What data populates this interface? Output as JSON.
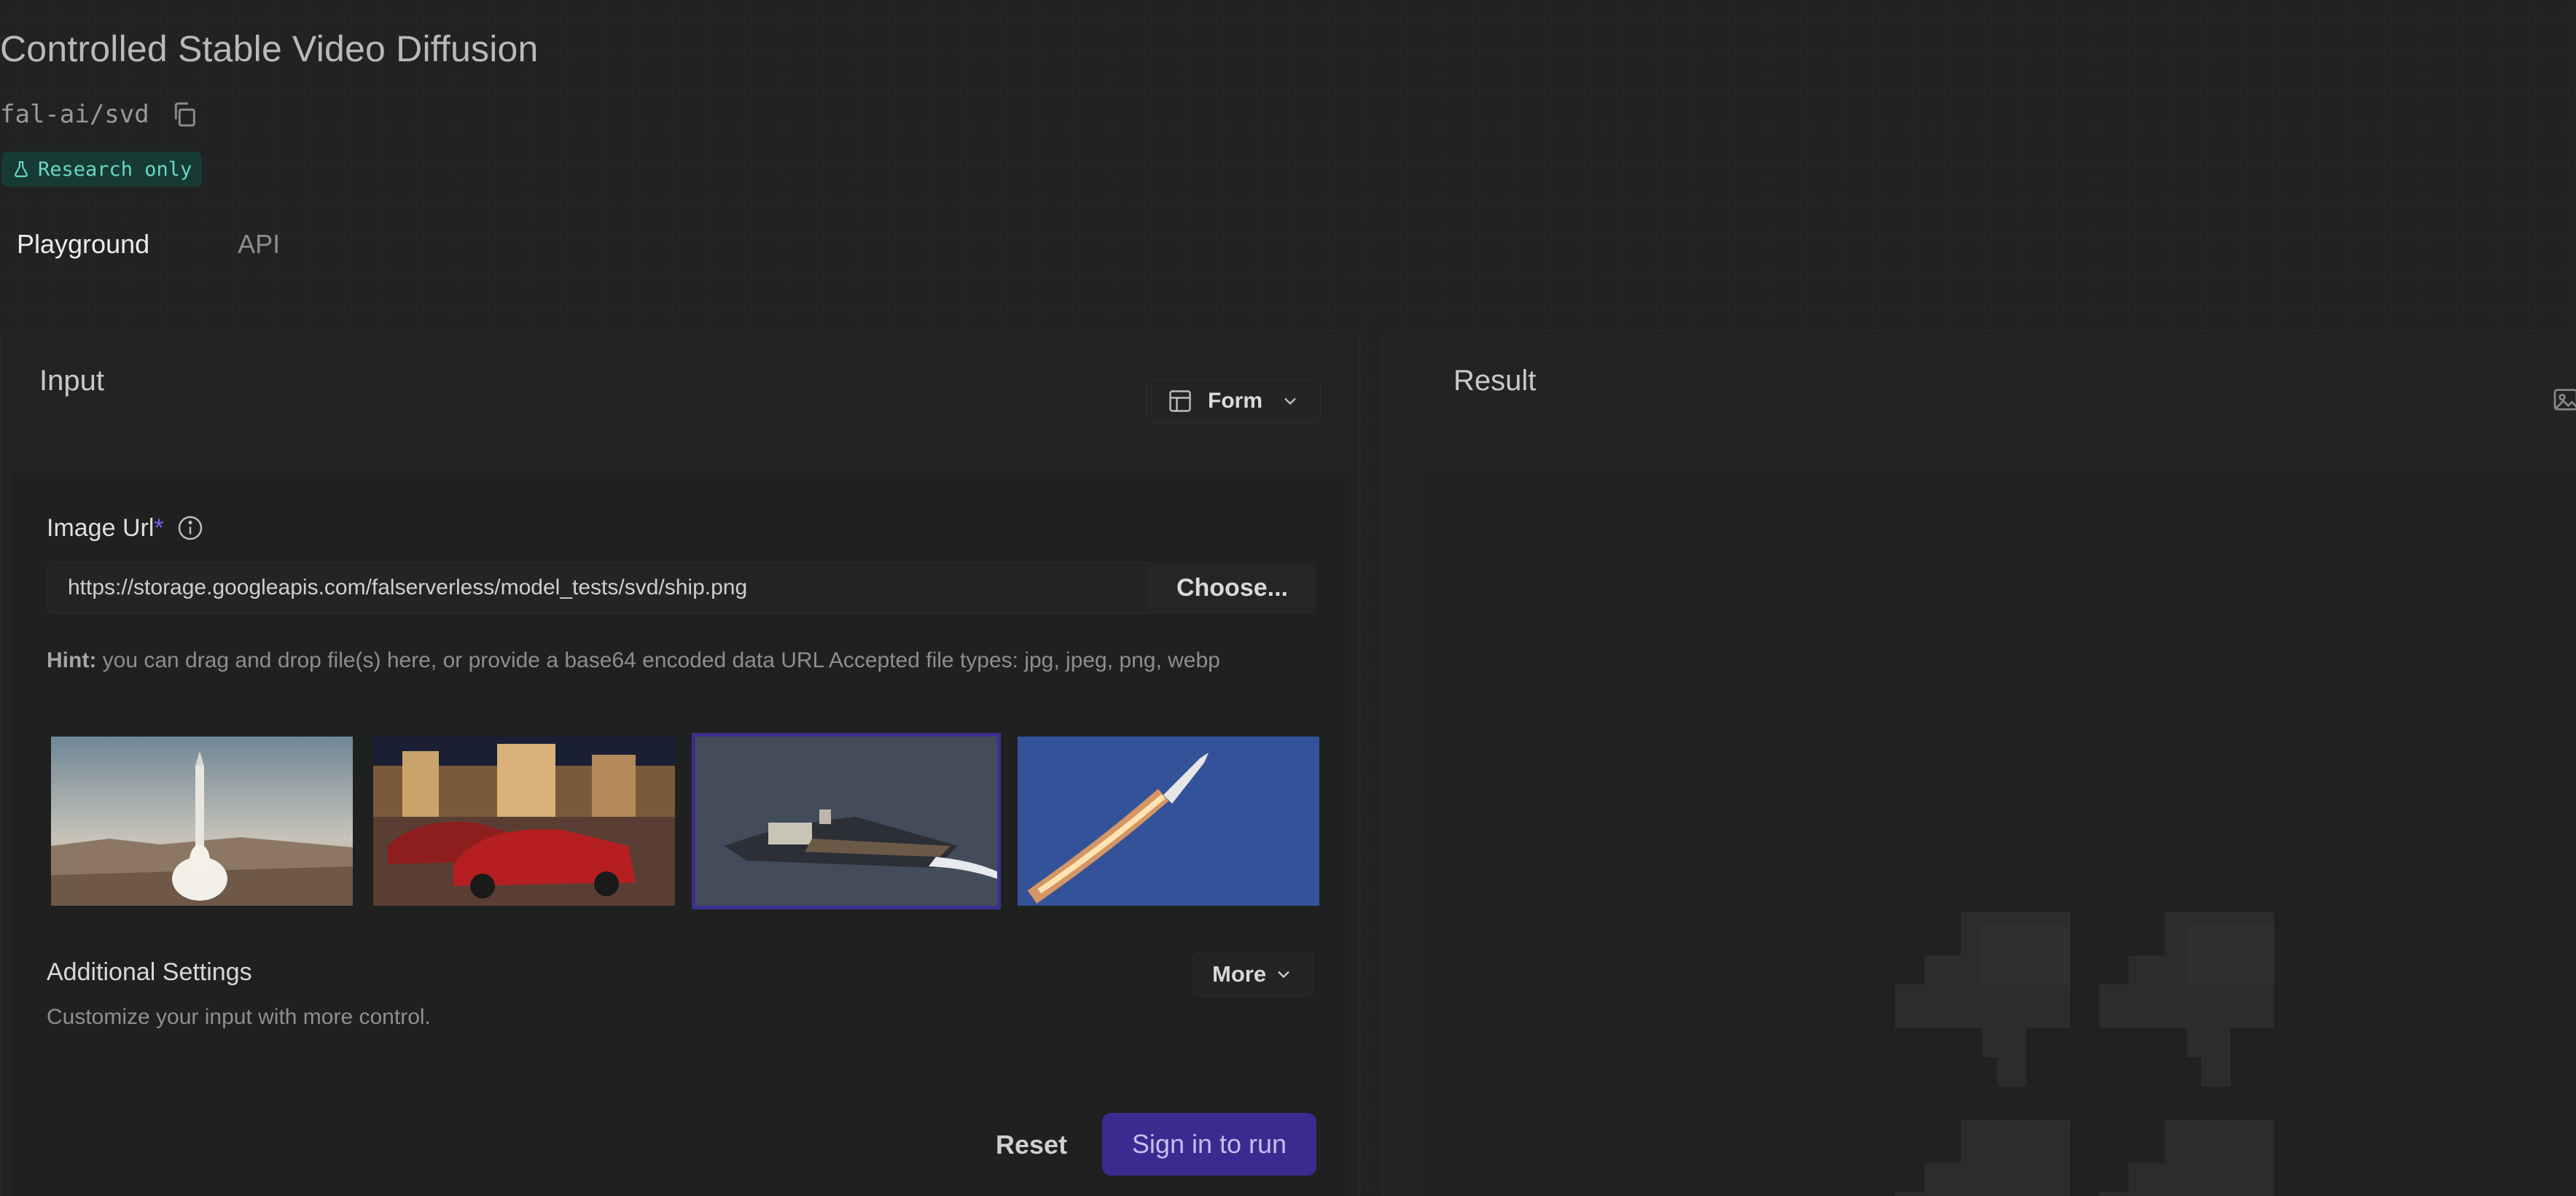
{
  "header": {
    "title": "Controlled Stable Video Diffusion",
    "model_id": "fal-ai/svd",
    "badge": "Research only"
  },
  "tabs": [
    {
      "label": "Playground",
      "active": true
    },
    {
      "label": "API",
      "active": false
    }
  ],
  "input_panel": {
    "title": "Input",
    "view_toggle": "Form",
    "image_url": {
      "label": "Image Url",
      "required_mark": "*",
      "value": "https://storage.googleapis.com/falserverless/model_tests/svd/ship.png",
      "choose_label": "Choose..."
    },
    "hint_prefix": "Hint:",
    "hint_text": " you can drag and drop file(s) here, or provide a base64 encoded data URL Accepted file types: jpg, jpeg, png, webp",
    "examples": [
      {
        "name": "rocket-launch",
        "selected": false
      },
      {
        "name": "red-cars-las-vegas",
        "selected": false
      },
      {
        "name": "ship",
        "selected": true
      },
      {
        "name": "rocket-sky",
        "selected": false
      }
    ],
    "additional_settings": {
      "title": "Additional Settings",
      "subtitle": "Customize your input with more control.",
      "more_label": "More"
    },
    "reset_label": "Reset",
    "run_label": "Sign in to run"
  },
  "result_panel": {
    "title": "Result"
  },
  "colors": {
    "background": "#212222",
    "accent": "#3a2b90",
    "badge_bg": "#173a34",
    "badge_text": "#67d8c2",
    "required": "#7b5cf6"
  },
  "icons": [
    "copy-icon",
    "flask-icon",
    "layout-icon",
    "chevron-down-icon",
    "info-icon",
    "image-icon"
  ]
}
